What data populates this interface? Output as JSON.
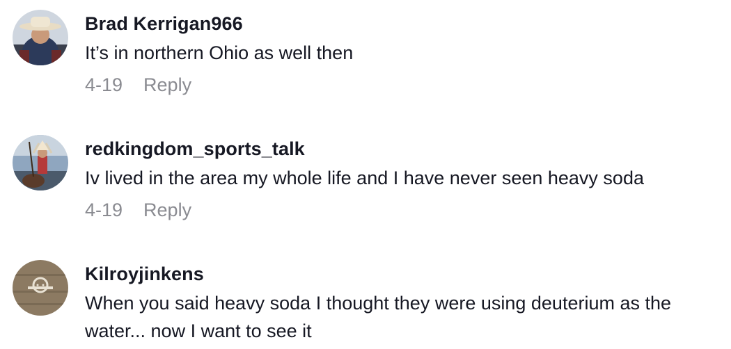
{
  "comments": [
    {
      "username": "Brad Kerrigan966",
      "text": "It’s in northern Ohio as well then",
      "date": "4-19",
      "reply_label": "Reply"
    },
    {
      "username": "redkingdom_sports_talk",
      "text": "Iv lived in the area my whole life and I have never seen heavy soda",
      "date": "4-19",
      "reply_label": "Reply"
    },
    {
      "username": "Kilroyjinkens",
      "text": "When you said heavy soda I thought they were using deuterium as the water... now I want to see it"
    }
  ]
}
